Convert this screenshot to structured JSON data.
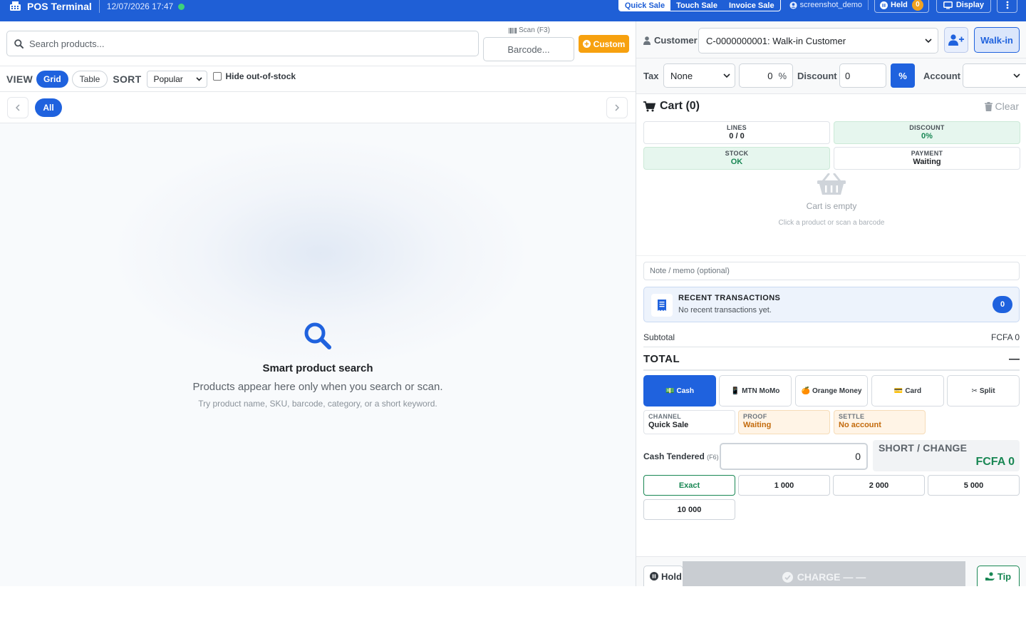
{
  "app": {
    "title": "POS Terminal",
    "datetime": "12/07/2026 17:47",
    "status_color": "#3ed17a"
  },
  "topbar": {
    "modes": [
      "Quick Sale",
      "Touch Sale",
      "Invoice Sale"
    ],
    "active_mode": "Quick Sale",
    "user": "screenshot_demo",
    "held_label": "Held",
    "held_count": "0",
    "display_label": "Display"
  },
  "search": {
    "placeholder": "Search products...",
    "scan_label": "Scan (F3)",
    "barcode_placeholder": "Barcode...",
    "custom_label": "Custom"
  },
  "view": {
    "view_label": "VIEW",
    "grid_label": "Grid",
    "table_label": "Table",
    "active": "Grid",
    "sort_label": "SORT",
    "sort_value": "Popular",
    "hide_oos_label": "Hide out-of-stock",
    "hide_oos_checked": false
  },
  "categories": {
    "items": [
      "All"
    ],
    "active": "All"
  },
  "empty_state": {
    "title": "Smart product search",
    "subtitle": "Products appear here only when you search or scan.",
    "hint": "Try product name, SKU, barcode, category, or a short keyword."
  },
  "customer": {
    "label": "Customer",
    "selected": "C-0000000001: Walk-in Customer",
    "walkin_label": "Walk-in"
  },
  "tax": {
    "label": "Tax",
    "selected": "None",
    "rate": "0",
    "pct_symbol": "%",
    "discount_label": "Discount",
    "discount_value": "0",
    "discount_mode": "%",
    "account_label": "Account",
    "account_value": ""
  },
  "cart": {
    "title": "Cart (0)",
    "clear_label": "Clear",
    "stats": {
      "lines_label": "LINES",
      "lines_value": "0 / 0",
      "discount_label": "DISCOUNT",
      "discount_value": "0%",
      "stock_label": "STOCK",
      "stock_value": "OK",
      "payment_label": "PAYMENT",
      "payment_value": "Waiting"
    },
    "empty_title": "Cart is empty",
    "empty_hint": "Click a product or scan a barcode",
    "note_placeholder": "Note / memo (optional)"
  },
  "recent": {
    "title": "RECENT TRANSACTIONS",
    "subtitle": "No recent transactions yet.",
    "count": "0"
  },
  "totals": {
    "subtotal_label": "Subtotal",
    "subtotal_value": "FCFA 0",
    "total_label": "TOTAL",
    "total_value": "—"
  },
  "payment": {
    "methods": [
      {
        "label": "Cash",
        "icon": "💵"
      },
      {
        "label": "MTN MoMo",
        "icon": "📱"
      },
      {
        "label": "Orange Money",
        "icon": "🍊"
      },
      {
        "label": "Card",
        "icon": "💳"
      },
      {
        "label": "Split",
        "icon": "✂"
      }
    ],
    "active": "Cash",
    "channel_label": "CHANNEL",
    "channel_value": "Quick Sale",
    "proof_label": "PROOF",
    "proof_value": "Waiting",
    "settle_label": "SETTLE",
    "settle_value": "No account",
    "cash_tendered_label": "Cash Tendered",
    "cash_tendered_key": "(F6)",
    "cash_tendered_value": "0",
    "change_label": "SHORT / CHANGE",
    "change_value": "FCFA 0",
    "quick_amounts": [
      "Exact",
      "1 000",
      "2 000",
      "5 000",
      "10 000"
    ]
  },
  "actions": {
    "hold_label": "Hold",
    "charge_label": "CHARGE — —",
    "tip_label": "Tip"
  },
  "colors": {
    "primary": "#1f62de",
    "topbar": "#1f5fd6",
    "accent_orange": "#f7a10f",
    "success": "#198754"
  }
}
